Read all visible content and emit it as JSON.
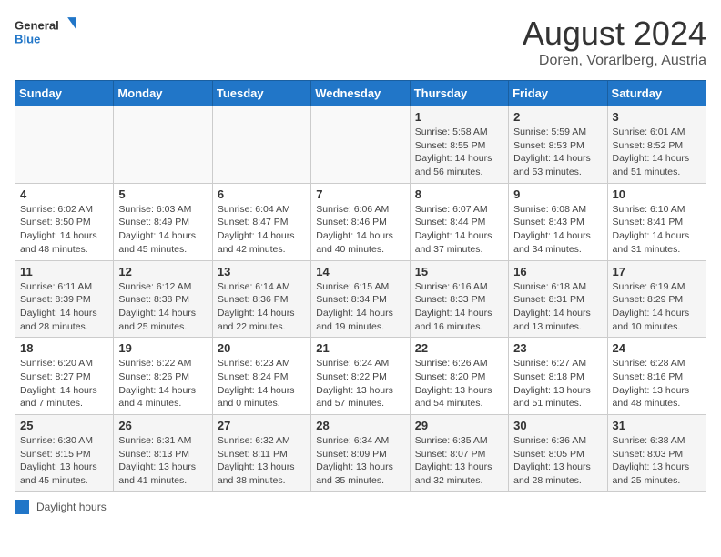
{
  "header": {
    "logo_line1": "General",
    "logo_line2": "Blue",
    "title": "August 2024",
    "subtitle": "Doren, Vorarlberg, Austria"
  },
  "legend": {
    "box_label": "Daylight hours"
  },
  "weekdays": [
    "Sunday",
    "Monday",
    "Tuesday",
    "Wednesday",
    "Thursday",
    "Friday",
    "Saturday"
  ],
  "weeks": [
    [
      {
        "day": "",
        "info": ""
      },
      {
        "day": "",
        "info": ""
      },
      {
        "day": "",
        "info": ""
      },
      {
        "day": "",
        "info": ""
      },
      {
        "day": "1",
        "info": "Sunrise: 5:58 AM\nSunset: 8:55 PM\nDaylight: 14 hours\nand 56 minutes."
      },
      {
        "day": "2",
        "info": "Sunrise: 5:59 AM\nSunset: 8:53 PM\nDaylight: 14 hours\nand 53 minutes."
      },
      {
        "day": "3",
        "info": "Sunrise: 6:01 AM\nSunset: 8:52 PM\nDaylight: 14 hours\nand 51 minutes."
      }
    ],
    [
      {
        "day": "4",
        "info": "Sunrise: 6:02 AM\nSunset: 8:50 PM\nDaylight: 14 hours\nand 48 minutes."
      },
      {
        "day": "5",
        "info": "Sunrise: 6:03 AM\nSunset: 8:49 PM\nDaylight: 14 hours\nand 45 minutes."
      },
      {
        "day": "6",
        "info": "Sunrise: 6:04 AM\nSunset: 8:47 PM\nDaylight: 14 hours\nand 42 minutes."
      },
      {
        "day": "7",
        "info": "Sunrise: 6:06 AM\nSunset: 8:46 PM\nDaylight: 14 hours\nand 40 minutes."
      },
      {
        "day": "8",
        "info": "Sunrise: 6:07 AM\nSunset: 8:44 PM\nDaylight: 14 hours\nand 37 minutes."
      },
      {
        "day": "9",
        "info": "Sunrise: 6:08 AM\nSunset: 8:43 PM\nDaylight: 14 hours\nand 34 minutes."
      },
      {
        "day": "10",
        "info": "Sunrise: 6:10 AM\nSunset: 8:41 PM\nDaylight: 14 hours\nand 31 minutes."
      }
    ],
    [
      {
        "day": "11",
        "info": "Sunrise: 6:11 AM\nSunset: 8:39 PM\nDaylight: 14 hours\nand 28 minutes."
      },
      {
        "day": "12",
        "info": "Sunrise: 6:12 AM\nSunset: 8:38 PM\nDaylight: 14 hours\nand 25 minutes."
      },
      {
        "day": "13",
        "info": "Sunrise: 6:14 AM\nSunset: 8:36 PM\nDaylight: 14 hours\nand 22 minutes."
      },
      {
        "day": "14",
        "info": "Sunrise: 6:15 AM\nSunset: 8:34 PM\nDaylight: 14 hours\nand 19 minutes."
      },
      {
        "day": "15",
        "info": "Sunrise: 6:16 AM\nSunset: 8:33 PM\nDaylight: 14 hours\nand 16 minutes."
      },
      {
        "day": "16",
        "info": "Sunrise: 6:18 AM\nSunset: 8:31 PM\nDaylight: 14 hours\nand 13 minutes."
      },
      {
        "day": "17",
        "info": "Sunrise: 6:19 AM\nSunset: 8:29 PM\nDaylight: 14 hours\nand 10 minutes."
      }
    ],
    [
      {
        "day": "18",
        "info": "Sunrise: 6:20 AM\nSunset: 8:27 PM\nDaylight: 14 hours\nand 7 minutes."
      },
      {
        "day": "19",
        "info": "Sunrise: 6:22 AM\nSunset: 8:26 PM\nDaylight: 14 hours\nand 4 minutes."
      },
      {
        "day": "20",
        "info": "Sunrise: 6:23 AM\nSunset: 8:24 PM\nDaylight: 14 hours\nand 0 minutes."
      },
      {
        "day": "21",
        "info": "Sunrise: 6:24 AM\nSunset: 8:22 PM\nDaylight: 13 hours\nand 57 minutes."
      },
      {
        "day": "22",
        "info": "Sunrise: 6:26 AM\nSunset: 8:20 PM\nDaylight: 13 hours\nand 54 minutes."
      },
      {
        "day": "23",
        "info": "Sunrise: 6:27 AM\nSunset: 8:18 PM\nDaylight: 13 hours\nand 51 minutes."
      },
      {
        "day": "24",
        "info": "Sunrise: 6:28 AM\nSunset: 8:16 PM\nDaylight: 13 hours\nand 48 minutes."
      }
    ],
    [
      {
        "day": "25",
        "info": "Sunrise: 6:30 AM\nSunset: 8:15 PM\nDaylight: 13 hours\nand 45 minutes."
      },
      {
        "day": "26",
        "info": "Sunrise: 6:31 AM\nSunset: 8:13 PM\nDaylight: 13 hours\nand 41 minutes."
      },
      {
        "day": "27",
        "info": "Sunrise: 6:32 AM\nSunset: 8:11 PM\nDaylight: 13 hours\nand 38 minutes."
      },
      {
        "day": "28",
        "info": "Sunrise: 6:34 AM\nSunset: 8:09 PM\nDaylight: 13 hours\nand 35 minutes."
      },
      {
        "day": "29",
        "info": "Sunrise: 6:35 AM\nSunset: 8:07 PM\nDaylight: 13 hours\nand 32 minutes."
      },
      {
        "day": "30",
        "info": "Sunrise: 6:36 AM\nSunset: 8:05 PM\nDaylight: 13 hours\nand 28 minutes."
      },
      {
        "day": "31",
        "info": "Sunrise: 6:38 AM\nSunset: 8:03 PM\nDaylight: 13 hours\nand 25 minutes."
      }
    ]
  ]
}
